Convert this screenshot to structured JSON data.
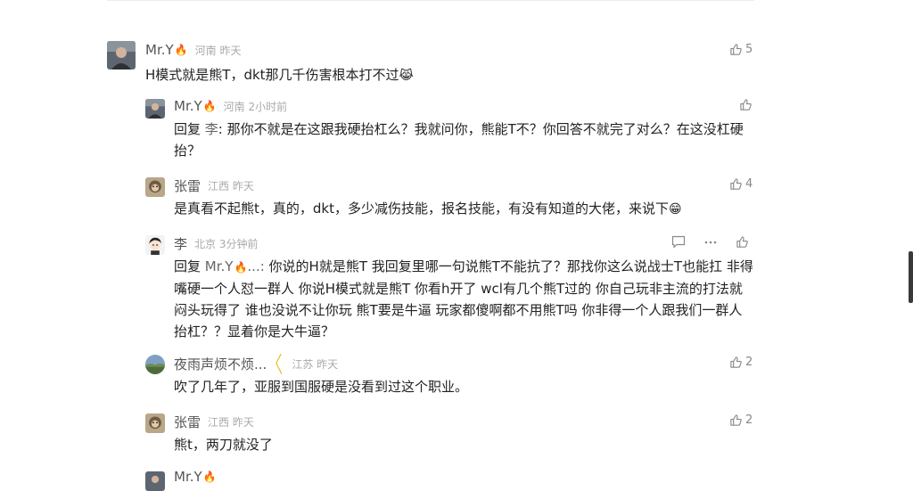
{
  "comments": [
    {
      "user": "Mr.Y",
      "fire": "🔥",
      "meta": "河南 昨天",
      "text": "H模式就是熊T，dkt那几千伤害根本打不过",
      "emoji": "😹",
      "likes": "5",
      "avatar_icon": "photo-avatar-man"
    },
    {
      "user": "Mr.Y",
      "fire": "🔥",
      "meta": "河南 2小时前",
      "reply_prefix": "回复 ",
      "reply_to": "李",
      "text": ": 那你不就是在这跟我硬抬杠么？我就问你，熊能T不？你回答不就完了对么？在这没杠硬抬？",
      "likes": "",
      "avatar_icon": "photo-avatar-man"
    },
    {
      "user": "张雷",
      "meta": "江西 昨天",
      "text": "是真看不起熊t，真的，dkt，多少减伤技能，报名技能，有没有知道的大佬，来说下",
      "emoji": "😁",
      "likes": "4",
      "avatar_icon": "monkey-avatar"
    },
    {
      "user": "李",
      "meta": "北京 3分钟前",
      "reply_prefix": "回复 ",
      "reply_to": "Mr.Y",
      "fire": "🔥",
      "reply_suffix": "...: ",
      "text": "你说的H就是熊T 我回复里哪一句说熊T不能抗了？那找你这么说战士T也能扛 非得嘴硬一个人怼一群人 你说H模式就是熊T 你看h开了 wcl有几个熊T过的 你自己玩非主流的打法就闷头玩得了 谁也没说不让你玩 熊T要是牛逼 玩家都傻啊都不用熊T吗 你非得一个人跟我们一群人抬杠？？显着你是大牛逼？",
      "likes": "",
      "avatar_icon": "cartoon-avatar"
    },
    {
      "user": "夜雨声烦不烦...",
      "badge": "〳〵",
      "meta": "江苏 昨天",
      "text": "吹了几年了，亚服到国服硬是没看到过这个职业。",
      "likes": "2",
      "avatar_icon": "landscape-avatar"
    },
    {
      "user": "张雷",
      "meta": "江西 昨天",
      "text": "熊t，两刀就没了",
      "likes": "2",
      "avatar_icon": "monkey-avatar"
    },
    {
      "user": "Mr.Y",
      "fire": "🔥",
      "meta": "",
      "text": "",
      "likes": "",
      "avatar_icon": "photo-avatar-man"
    }
  ],
  "icons": {
    "like": "thumbs-up-icon",
    "comment": "comment-icon",
    "more": "more-icon"
  }
}
